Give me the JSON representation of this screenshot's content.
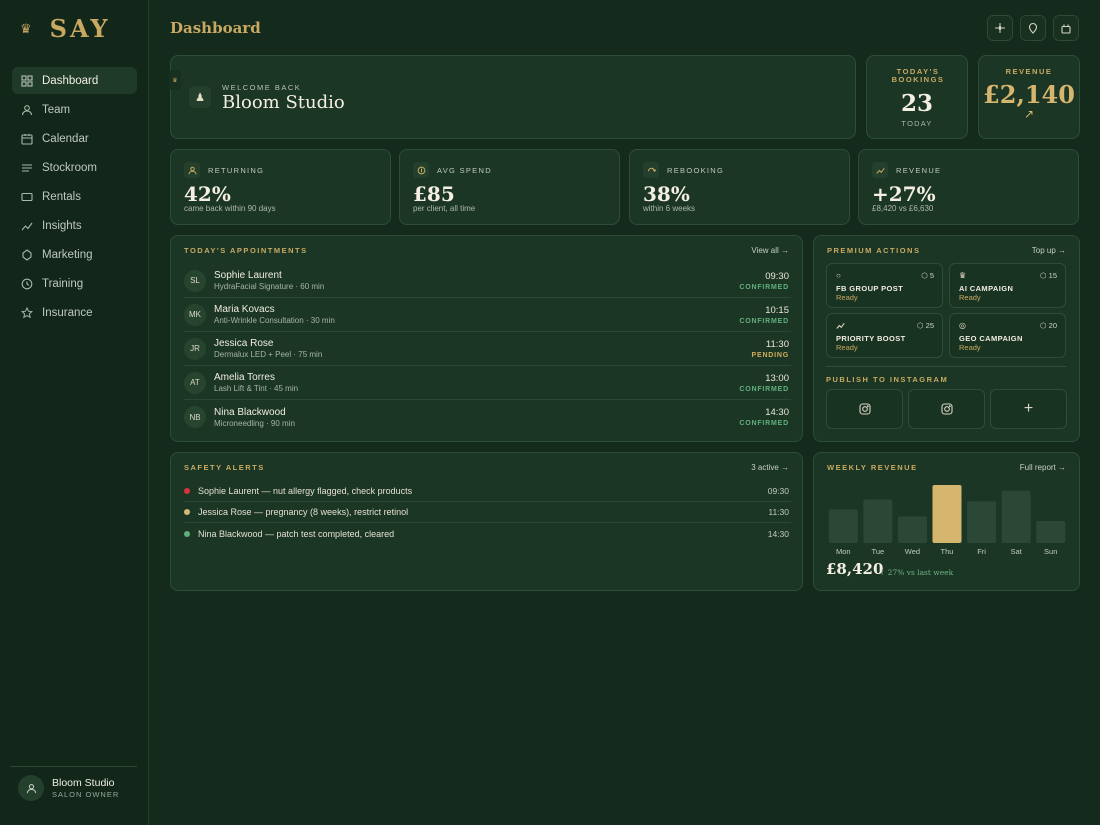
{
  "brand": {
    "name": "SAY",
    "crown_icon": "crown-icon"
  },
  "sidebar": {
    "items": [
      {
        "label": "Dashboard",
        "icon": "grid-icon",
        "active": true
      },
      {
        "label": "Team",
        "icon": "user-icon"
      },
      {
        "label": "Calendar",
        "icon": "calendar-icon"
      },
      {
        "label": "Stockroom",
        "icon": "lines-icon"
      },
      {
        "label": "Rentals",
        "icon": "rectangle-icon"
      },
      {
        "label": "Insights",
        "icon": "trend-icon"
      },
      {
        "label": "Marketing",
        "icon": "tag-icon"
      },
      {
        "label": "Training",
        "icon": "clock-icon"
      },
      {
        "label": "Insurance",
        "icon": "star-icon"
      }
    ],
    "user": {
      "name": "Bloom Studio",
      "role": "SALON OWNER"
    }
  },
  "header": {
    "title": "Dashboard",
    "buttons": [
      "sparkle-icon",
      "location-icon",
      "bag-icon"
    ]
  },
  "welcome": {
    "kicker": "WELCOME BACK",
    "name": "Bloom Studio"
  },
  "bookings": {
    "label": "TODAY'S BOOKINGS",
    "value": "23",
    "sub": "TODAY"
  },
  "revenue_top": {
    "label": "REVENUE",
    "value": "£2,140",
    "arrow": "↗"
  },
  "metrics": [
    {
      "label": "RETURNING",
      "value": "42%",
      "sub": "came back within 90 days",
      "icon": "user-icon"
    },
    {
      "label": "AVG SPEND",
      "value": "£85",
      "sub": "per client, all time",
      "icon": "coin-icon"
    },
    {
      "label": "REBOOKING",
      "value": "38%",
      "sub": "within 6 weeks",
      "icon": "refresh-icon"
    },
    {
      "label": "REVENUE",
      "value": "+27%",
      "sub": "£8,420 vs £6,630",
      "icon": "trend-icon"
    }
  ],
  "appointments": {
    "title": "TODAY'S APPOINTMENTS",
    "link": "View all →",
    "rows": [
      {
        "initials": "SL",
        "name": "Sophie Laurent",
        "detail": "HydraFacial Signature · 60 min",
        "time": "09:30",
        "status": "CONFIRMED",
        "status_color": "#63b07c"
      },
      {
        "initials": "MK",
        "name": "Maria Kovacs",
        "detail": "Anti-Wrinkle Consultation · 30 min",
        "time": "10:15",
        "status": "CONFIRMED",
        "status_color": "#63b07c"
      },
      {
        "initials": "JR",
        "name": "Jessica Rose",
        "detail": "Dermalux LED + Peel · 75 min",
        "time": "11:30",
        "status": "PENDING",
        "status_color": "#d3ad5c"
      },
      {
        "initials": "AT",
        "name": "Amelia Torres",
        "detail": "Lash Lift & Tint · 45 min",
        "time": "13:00",
        "status": "CONFIRMED",
        "status_color": "#63b07c"
      },
      {
        "initials": "NB",
        "name": "Nina Blackwood",
        "detail": "Microneedling · 90 min",
        "time": "14:30",
        "status": "CONFIRMED",
        "status_color": "#63b07c"
      }
    ]
  },
  "premium": {
    "title": "PREMIUM ACTIONS",
    "link": "Top up →",
    "actions": [
      {
        "name": "FB GROUP POST",
        "status": "Ready",
        "cost": "5",
        "icon": "circle-icon"
      },
      {
        "name": "AI CAMPAIGN",
        "status": "Ready",
        "cost": "15",
        "icon": "crown-icon"
      },
      {
        "name": "PRIORITY BOOST",
        "status": "Ready",
        "cost": "25",
        "icon": "trend-icon"
      },
      {
        "name": "GEO CAMPAIGN",
        "status": "Ready",
        "cost": "20",
        "icon": "target-icon"
      }
    ],
    "publish_title": "PUBLISH TO INSTAGRAM",
    "publish_tiles": [
      "instagram-icon",
      "instagram-icon",
      "plus-icon"
    ]
  },
  "safety": {
    "title": "SAFETY ALERTS",
    "link": "3 active →",
    "alerts": [
      {
        "text": "Sophie Laurent — nut allergy flagged, check products",
        "time": "09:30",
        "color": "#d8323c"
      },
      {
        "text": "Jessica Rose — pregnancy (8 weeks), restrict retinol",
        "time": "11:30",
        "color": "#d9b872"
      },
      {
        "text": "Nina Blackwood — patch test completed, cleared",
        "time": "14:30",
        "color": "#5fb07a"
      }
    ]
  },
  "weekly": {
    "title": "WEEKLY REVENUE",
    "link": "Full report →",
    "total": "£8,420",
    "change": "↑ 27% vs last week"
  },
  "chart_data": {
    "type": "bar",
    "categories": [
      "Mon",
      "Tue",
      "Wed",
      "Thu",
      "Fri",
      "Sat",
      "Sun"
    ],
    "values": [
      58,
      75,
      46,
      100,
      72,
      90,
      38
    ],
    "highlight": "Thu",
    "bar_color": "#2b4735",
    "highlight_color": "#d6b66e"
  }
}
